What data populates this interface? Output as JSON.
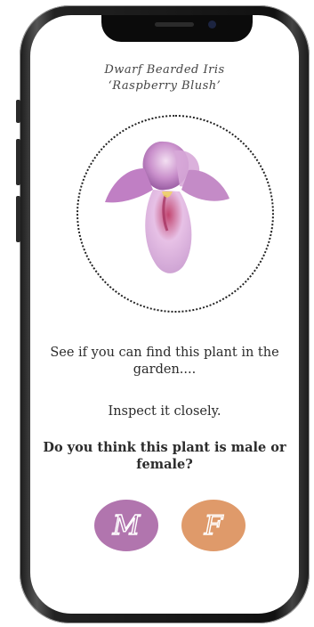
{
  "plant": {
    "name_line1": "Dwarf Bearded Iris",
    "name_line2": "‘Raspberry Blush’"
  },
  "instructions": {
    "find": "See if you can find this plant in the garden....",
    "inspect": "Inspect it closely.",
    "question": "Do you think this plant is male or female?"
  },
  "choices": {
    "male_label": "M",
    "female_label": "F",
    "male_color": "#b175ae",
    "female_color": "#df9a6a"
  },
  "icons": {
    "flower": "iris-flower-photo"
  }
}
